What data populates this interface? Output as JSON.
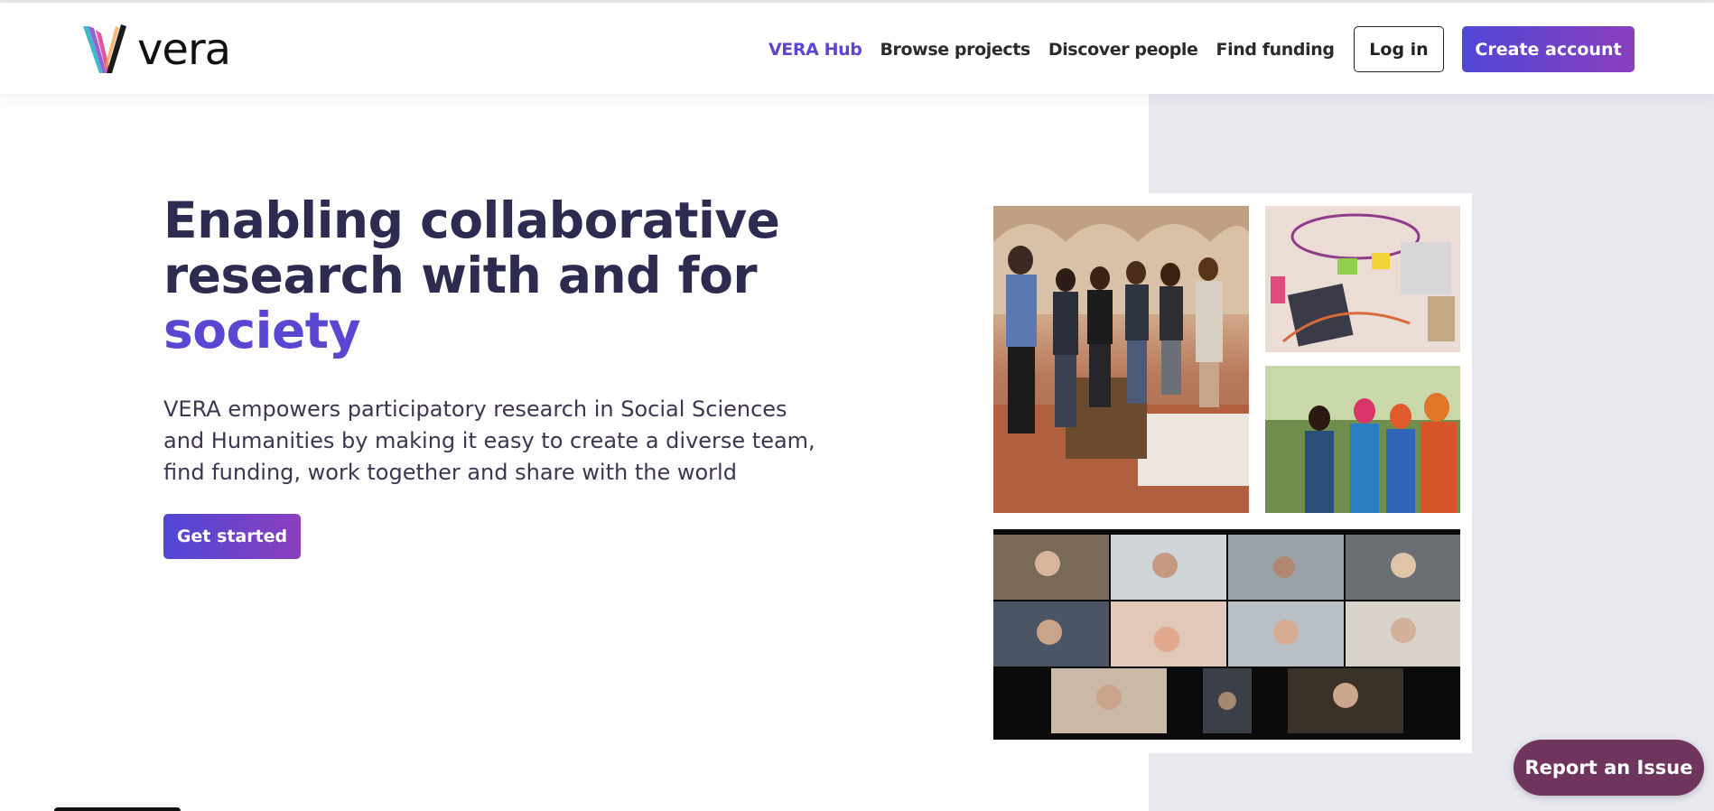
{
  "brand": {
    "name": "vera",
    "colors": {
      "primary": "#5a47d1",
      "gradient_end": "#8a3fbd",
      "heading": "#2e2b50",
      "report": "#70355e"
    }
  },
  "nav": {
    "items": [
      {
        "label": "VERA Hub",
        "active": true
      },
      {
        "label": "Browse projects",
        "active": false
      },
      {
        "label": "Discover people",
        "active": false
      },
      {
        "label": "Find funding",
        "active": false
      }
    ],
    "login_label": "Log in",
    "create_label": "Create account"
  },
  "hero": {
    "title_line1": "Enabling collaborative",
    "title_line2": "research with and for",
    "title_accent": "society",
    "description": "VERA empowers participatory research in Social Sciences and Humanities by making it easy to create a diverse team, find funding, work together and share with the world",
    "cta_label": "Get started"
  },
  "collage": {
    "photos": [
      "workshop-group-photo",
      "sticky-notes-photo",
      "field-research-photo",
      "video-call-photo"
    ]
  },
  "report_issue_label": "Report an Issue"
}
